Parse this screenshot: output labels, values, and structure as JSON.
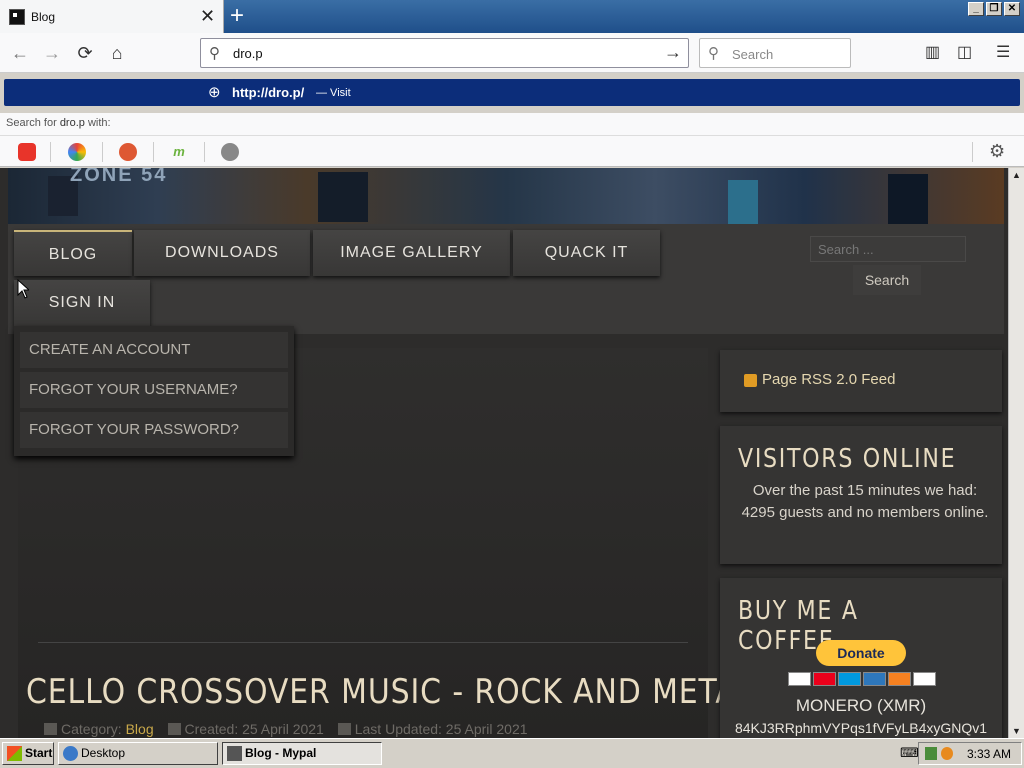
{
  "browser": {
    "tab_title": "Blog",
    "url_value": "dro.p",
    "search_placeholder": "Search",
    "window_controls": [
      "_",
      "❐",
      "✕"
    ]
  },
  "dropdown": {
    "visit_url": "http://dro.p/",
    "visit_label": "— Visit",
    "search_for_prefix": "Search for",
    "search_for_term": "dro.p",
    "search_for_suffix": "with:"
  },
  "site": {
    "logo_text": "ZONE 54",
    "menu": [
      {
        "label": "BLOG"
      },
      {
        "label": "DOWNLOADS"
      },
      {
        "label": "IMAGE GALLERY"
      },
      {
        "label": "QUACK IT"
      },
      {
        "label": "SIGN IN"
      }
    ],
    "submenu": [
      {
        "label": "CREATE AN ACCOUNT"
      },
      {
        "label": "FORGOT YOUR USERNAME?"
      },
      {
        "label": "FORGOT YOUR PASSWORD?"
      }
    ],
    "search_placeholder": "Search ...",
    "search_button": "Search"
  },
  "article": {
    "title": "CELLO CROSSOVER MUSIC - ROCK AND METAL",
    "category_label": "Category:",
    "category": "Blog",
    "created": "Created: 25 April 2021",
    "updated": "Last Updated: 25 April 2021"
  },
  "sidebar": {
    "rss": "Page RSS 2.0 Feed",
    "visitors_title": "VISITORS ONLINE",
    "visitors_text": "Over the past 15 minutes we had: 4295 guests and no members online.",
    "coffee_title": "BUY ME A COFFEE",
    "donate": "Donate",
    "monero": "MONERO (XMR)",
    "address": "84KJ3RRphmVYPqs1fVFyLB4xyGNQv1"
  },
  "taskbar": {
    "start": "Start",
    "desktop": "Desktop",
    "active_window": "Blog - Mypal",
    "time": "3:33 AM"
  },
  "colors": {
    "visit_row_bg": "#0c2d7a",
    "accent_heading": "#e8dcc2",
    "link": "#c9a94a",
    "donate_bg": "#ffc43a"
  }
}
